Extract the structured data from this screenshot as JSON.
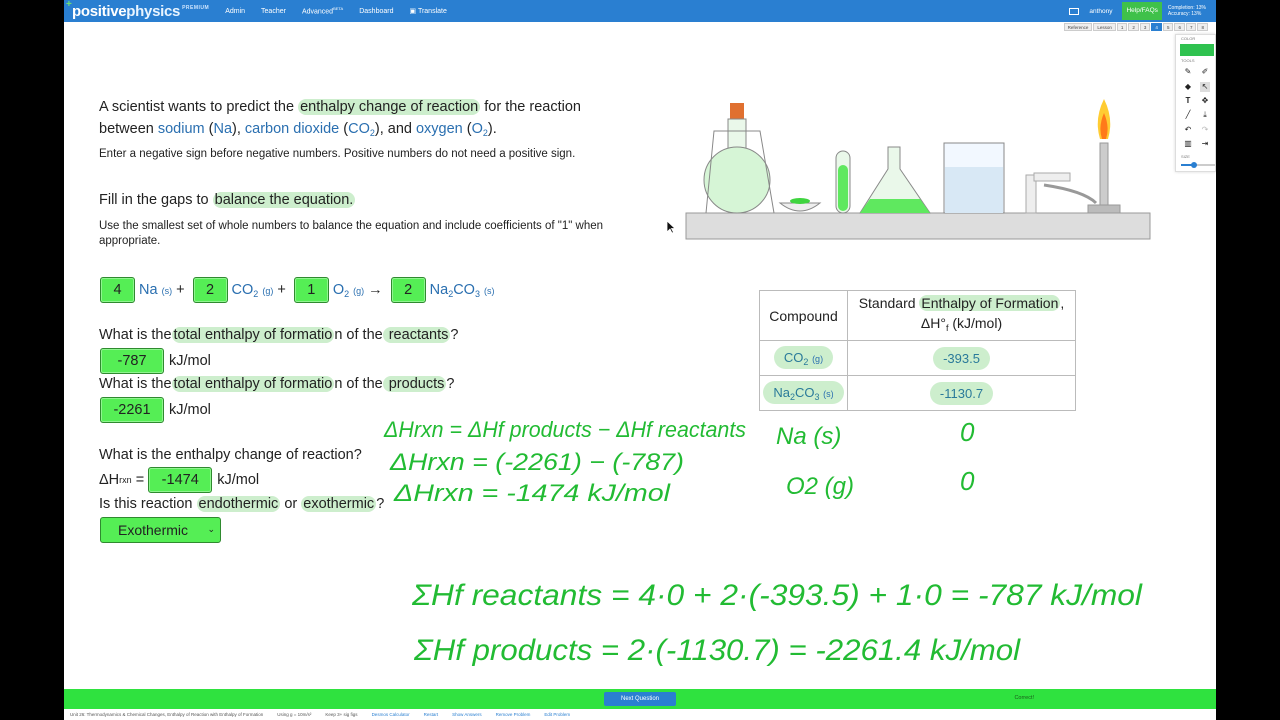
{
  "nav": {
    "logo_a": "positive",
    "logo_b": "physics",
    "premium": "PREMIUM",
    "links": [
      "Admin",
      "Teacher",
      "Advanced",
      "Dashboard",
      "Translate"
    ],
    "advanced_badge": "BETA",
    "user": "anthony",
    "help": "Help/FAQs",
    "completion": "Completion: 13%",
    "accuracy": "Accuracy: 13%"
  },
  "tabs": [
    "Reference",
    "Lesson",
    "1",
    "2",
    "3",
    "4",
    "5",
    "6",
    "7",
    "8"
  ],
  "active_tab": "4",
  "problem": {
    "l1a": "A scientist wants to predict the ",
    "l1b": "enthalpy change of reaction",
    "l1c": " for the reaction",
    "l2a": "between ",
    "sodium": "sodium",
    "na": "Na",
    "co2name": "carbon dioxide",
    "co2a": "CO",
    "o2name": "oxygen",
    "o2a": "O",
    "two": "2",
    "and": ", and ",
    "note": "Enter a negative sign before negative numbers. Positive numbers do not need a positive sign.",
    "fill_a": "Fill in the gaps to ",
    "fill_b": "balance the equation.",
    "use": "Use the smallest set of whole numbers to balance the equation and include coefficients of \"1\" when appropriate."
  },
  "equation": {
    "coef": [
      "4",
      "2",
      "1",
      "2"
    ],
    "na": "Na",
    "s": "(s)",
    "g": "(g)",
    "co": "CO",
    "o": "O",
    "na2": "Na",
    "co3": "CO",
    "sub2": "2",
    "sub3": "3",
    "plus": "+",
    "arrow": "→"
  },
  "q1": {
    "a": "What is the",
    "b": "total enthalpy of formatio",
    "c": "n of the",
    "d": " reactants",
    "e": "?",
    "value": "-787",
    "unit": "kJ/mol"
  },
  "q2": {
    "a": "What is the",
    "b": "total enthalpy of formatio",
    "c": "n of the",
    "d": " products",
    "e": "?",
    "value": "-2261",
    "unit": "kJ/mol"
  },
  "q3": {
    "text": "What is the enthalpy change of reaction?",
    "dh": "ΔH",
    "rxn": "rxn",
    "eq": " = ",
    "value": "-1474",
    "unit": "kJ/mol"
  },
  "q4": {
    "a": "Is this reaction ",
    "b": "endothermic",
    "c": " or ",
    "d": "exothermic",
    "e": "?",
    "selected": "Exothermic"
  },
  "table": {
    "h1": "Compound",
    "h2a": "Standard ",
    "h2b": "Enthalpy of Formation",
    "h2c": ",",
    "h2d": "ΔH°",
    "h2e": "f",
    "h2f": " (kJ/mol)",
    "r1c": "CO",
    "r1s": "(g)",
    "r1v": "-393.5",
    "r2c": "Na",
    "r2c2": "CO",
    "r2s": "(s)",
    "r2v": "-1130.7",
    "sub2": "2",
    "sub3": "3"
  },
  "tools": {
    "color": "COLOR",
    "tools": "TOOLS",
    "size": "SIZE",
    "accent": "#2fc24f"
  },
  "handwriting": {
    "l1": "ΔHrxn = ΔHf products − ΔHf reactants",
    "l2": "ΔHrxn = (-2261) − (-787)",
    "l3": "ΔHrxn = -1474 kJ/mol",
    "na": "Na (s)",
    "o2": "O2 (g)",
    "zero1": "0",
    "zero2": "0",
    "sum1": "ΣHf reactants = 4·0 + 2·(-393.5) + 1·0 = -787 kJ/mol",
    "sum2": "ΣHf products = 2·(-1130.7) = -2261.4 kJ/mol"
  },
  "bottom": {
    "next": "Next Question",
    "correct": "Correct!",
    "unit": "Unit 26: Thermodynamics & Chemical Changes, Enthalpy of Reaction with Enthalpy of Formation",
    "g": "Using g = 10m/s²",
    "sig": "Keep 3+ sig figs",
    "desmos": "Desmos Calculator",
    "restart": "Restart",
    "show": "Show Answers",
    "remove": "Remove Problem",
    "edit": "Edit Problem"
  },
  "colors": {
    "nav": "#2a7fd1",
    "answer": "#55ee55",
    "highlight": "#cdeecd",
    "ink": "#22bb33"
  }
}
